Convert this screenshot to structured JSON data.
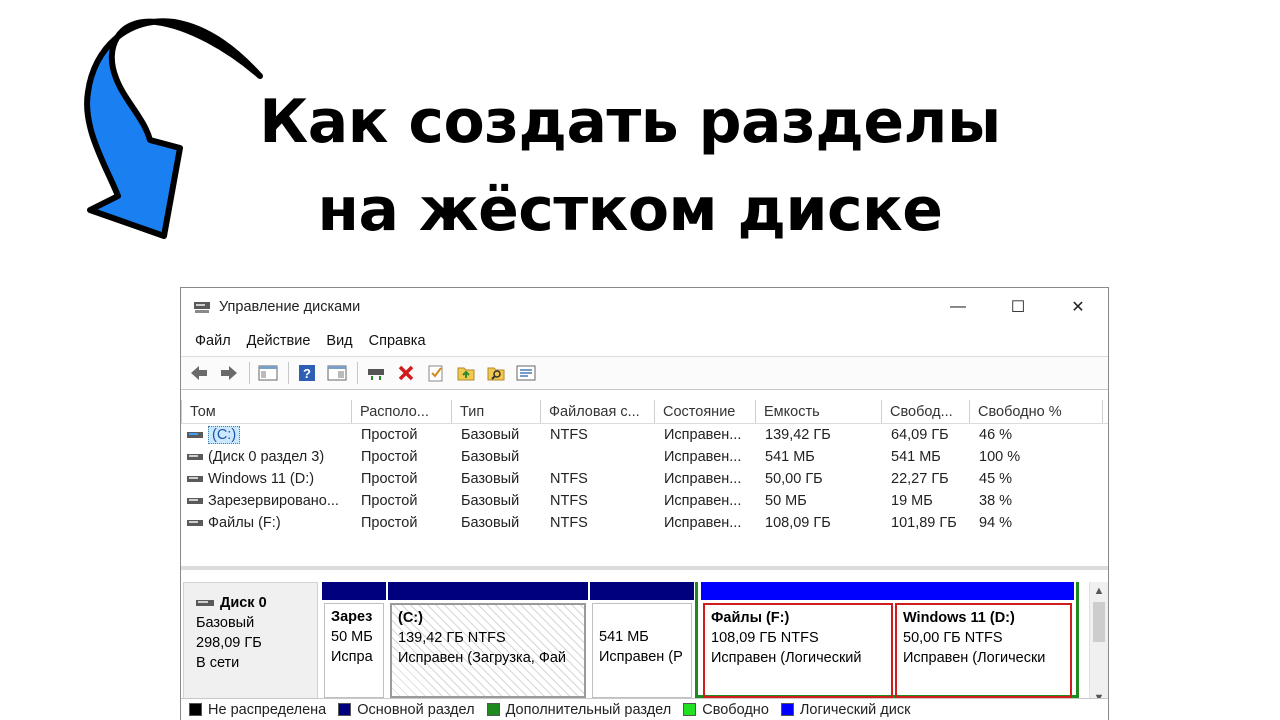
{
  "headline": {
    "line1": "Как создать разделы",
    "line2": "на жёстком диске"
  },
  "window": {
    "title": "Управление дисками",
    "controls": {
      "minimize": "—",
      "maximize": "☐",
      "close": "✕"
    },
    "menu": [
      "Файл",
      "Действие",
      "Вид",
      "Справка"
    ],
    "table": {
      "columns": [
        "Том",
        "Располо...",
        "Тип",
        "Файловая с...",
        "Состояние",
        "Емкость",
        "Свобод...",
        "Свободно %"
      ],
      "rows": [
        [
          "(C:)",
          "Простой",
          "Базовый",
          "NTFS",
          "Исправен...",
          "139,42 ГБ",
          "64,09 ГБ",
          "46 %"
        ],
        [
          "(Диск 0 раздел 3)",
          "Простой",
          "Базовый",
          "",
          "Исправен...",
          "541 МБ",
          "541 МБ",
          "100 %"
        ],
        [
          "Windows 11 (D:)",
          "Простой",
          "Базовый",
          "NTFS",
          "Исправен...",
          "50,00 ГБ",
          "22,27 ГБ",
          "45 %"
        ],
        [
          "Зарезервировано...",
          "Простой",
          "Базовый",
          "NTFS",
          "Исправен...",
          "50 МБ",
          "19 МБ",
          "38 %"
        ],
        [
          "Файлы (F:)",
          "Простой",
          "Базовый",
          "NTFS",
          "Исправен...",
          "108,09 ГБ",
          "101,89 ГБ",
          "94 %"
        ]
      ]
    },
    "disk": {
      "name": "Диск 0",
      "type": "Базовый",
      "size": "298,09 ГБ",
      "status": "В сети",
      "partitions": [
        {
          "title": "Зарез",
          "size": "50 МБ",
          "status": "Испра"
        },
        {
          "title": "(C:)",
          "size": "139,42 ГБ NTFS",
          "status": "Исправен (Загрузка, Фай"
        },
        {
          "title": "",
          "size": "541 МБ",
          "status": "Исправен (Р"
        },
        {
          "title": "Файлы  (F:)",
          "size": "108,09 ГБ NTFS",
          "status": "Исправен (Логический"
        },
        {
          "title": "Windows 11  (D:)",
          "size": "50,00 ГБ NTFS",
          "status": "Исправен (Логически"
        }
      ]
    },
    "legend": [
      "Не распределена",
      "Основной раздел",
      "Дополнительный раздел",
      "Свободно",
      "Логический диск"
    ],
    "colors": {
      "arrow": "#1a7ff0",
      "primary": "#00007f",
      "logical": "#0000ff",
      "extended": "#1f8a1f",
      "free": "#22e022",
      "unallocated": "#000000",
      "selected_border": "#d01c1c"
    }
  }
}
